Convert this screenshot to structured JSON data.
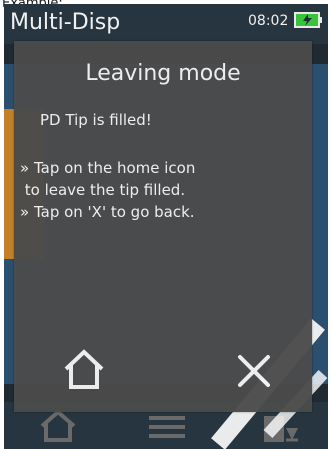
{
  "caption": "Example:",
  "status_bar": {
    "app_title": "Multi-Disp",
    "time": "08:02"
  },
  "modal": {
    "title": "Leaving mode",
    "status": "PD Tip is filled!",
    "instructions": [
      "» Tap on the home icon",
      " to leave the tip filled.",
      "» Tap on 'X' to go back."
    ],
    "buttons": {
      "home_icon": "home-icon",
      "close_icon": "close-icon"
    }
  },
  "background_nav": {
    "icons": [
      "home-icon",
      "menu-icon",
      "dispense-icon"
    ]
  },
  "colors": {
    "modal_bg": "#4b4b4b",
    "device_bg": "#1f2a33",
    "battery_accent": "#38c43a",
    "text": "#f4f4f4"
  }
}
